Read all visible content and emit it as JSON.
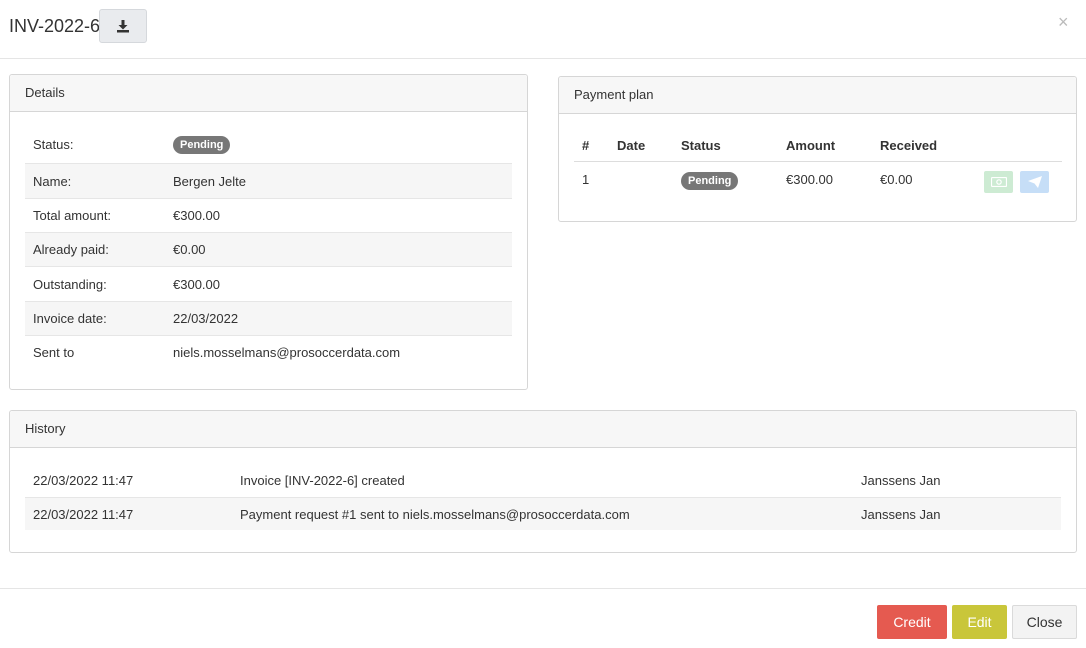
{
  "header": {
    "title": "INV-2022-6",
    "download_icon": "download-icon",
    "close_glyph": "×"
  },
  "details": {
    "title": "Details",
    "rows": [
      {
        "label": "Status:",
        "value": "Pending",
        "type": "badge"
      },
      {
        "label": "Name:",
        "value": "Bergen Jelte"
      },
      {
        "label": "Total amount:",
        "value": "€300.00"
      },
      {
        "label": "Already paid:",
        "value": "€0.00"
      },
      {
        "label": "Outstanding:",
        "value": "€300.00"
      },
      {
        "label": "Invoice date:",
        "value": "22/03/2022"
      },
      {
        "label": "Sent to",
        "value": "niels.mosselmans@prosoccerdata.com"
      }
    ]
  },
  "payment_plan": {
    "title": "Payment plan",
    "columns": [
      "#",
      "Date",
      "Status",
      "Amount",
      "Received"
    ],
    "rows": [
      {
        "num": "1",
        "date": "",
        "status": "Pending",
        "amount": "€300.00",
        "received": "€0.00"
      }
    ],
    "actions": {
      "register_payment_icon": "money-icon",
      "send_icon": "paper-plane-icon"
    }
  },
  "history": {
    "title": "History",
    "rows": [
      {
        "date": "22/03/2022 11:47",
        "description": "Invoice [INV-2022-6] created",
        "user": "Janssens Jan"
      },
      {
        "date": "22/03/2022 11:47",
        "description": "Payment request #1 sent to niels.mosselmans@prosoccerdata.com",
        "user": "Janssens Jan"
      }
    ]
  },
  "footer": {
    "credit_label": "Credit",
    "edit_label": "Edit",
    "close_label": "Close"
  },
  "colors": {
    "badge": "#777777",
    "credit": "#e55a50",
    "edit": "#c9c63a",
    "close_bg": "#f3f3f3",
    "money_btn": "#cdebd3",
    "send_btn": "#c6def7"
  }
}
